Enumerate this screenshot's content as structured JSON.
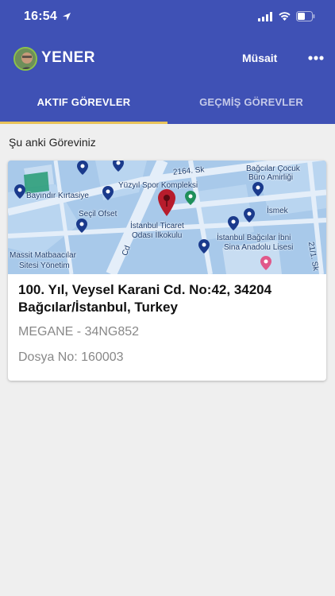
{
  "status_bar": {
    "time": "16:54"
  },
  "header": {
    "user_name": "YENER",
    "status": "Müsait"
  },
  "tabs": [
    {
      "label": "AKTIF GÖREVLER",
      "active": true
    },
    {
      "label": "GEÇMİŞ GÖREVLER",
      "active": false
    }
  ],
  "section": {
    "title": "Şu anki Göreviniz"
  },
  "task": {
    "address": "100. Yıl, Veysel Karani Cd. No:42, 34204 Bağcılar/İstanbul, Turkey",
    "vehicle": "MEGANE - 34NG852",
    "file_no": "Dosya No: 160003"
  },
  "map": {
    "labels": [
      "2164. Sk",
      "Bağcılar Çocuk",
      "Büro Amirliği",
      "Yüzyıl Spor Kompleksi",
      "Bayındır Kırtasiye",
      "Seçil Ofset",
      "İsmek",
      "İstanbul Ticaret",
      "Odası İlkokulu",
      "İstanbul Bağcılar İbni",
      "Sina Anadolu Lisesi",
      "Massit Matbaacılar",
      "Sitesi Yönetim",
      "Cd",
      "21/1. Sk"
    ]
  },
  "colors": {
    "primary": "#3f51b5",
    "accent": "#e8c35a",
    "pin": "#b71c2c",
    "avatar_ring": "#8bc34a"
  }
}
